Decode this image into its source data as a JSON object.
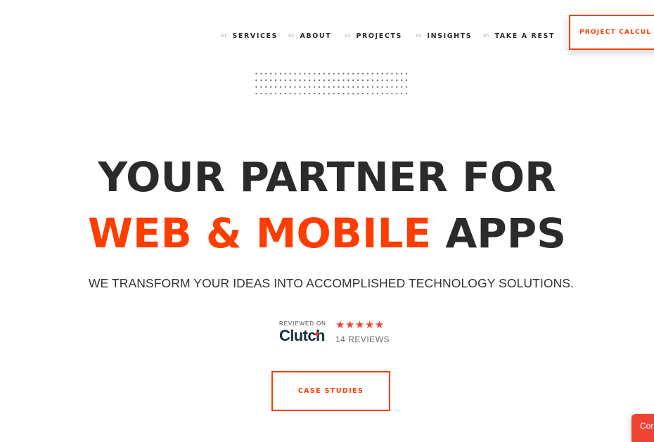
{
  "nav": {
    "items": [
      {
        "num": "01",
        "label": "SERVICES"
      },
      {
        "num": "02",
        "label": "ABOUT"
      },
      {
        "num": "03",
        "label": "PROJECTS"
      },
      {
        "num": "04",
        "label": "INSIGHTS"
      },
      {
        "num": "05",
        "label": "TAKE A REST"
      }
    ],
    "cta_label": "PROJECT CALCUL"
  },
  "hero": {
    "line1": "YOUR PARTNER FOR",
    "line2_accent": "WEB & MOBILE",
    "line2_rest": " APPS",
    "subtitle": "WE TRANSFORM YOUR IDEAS INTO ACCOMPLISHED TECHNOLOGY SOLUTIONS."
  },
  "clutch": {
    "reviewed_on": "REVIEWED ON",
    "logo_text": "Clutch",
    "stars": "★★★★★",
    "rating_stars": 5,
    "reviews": "14 REVIEWS"
  },
  "case_studies_label": "CASE STUDIES",
  "contact_tab_label": "Cor",
  "colors": {
    "accent": "#ff3d00",
    "text_dark": "#2b2b2b",
    "clutch_red": "#ef4335",
    "clutch_navy": "#17313b"
  }
}
